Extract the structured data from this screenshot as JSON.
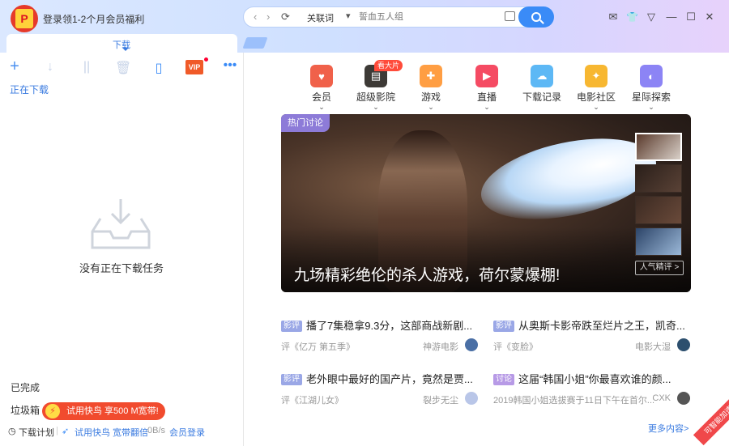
{
  "window": {
    "login_text": "登录领1-2个月会员福利",
    "avatar_letter": "P",
    "controls": {
      "mail": "✉",
      "skin": "👕",
      "menu": "▽",
      "minimize": "—",
      "maximize": "☐",
      "close": "✕"
    }
  },
  "search": {
    "back": "‹",
    "forward": "›",
    "refresh": "⟳",
    "keyword_label": "关联词",
    "keyword_arrow": "▾",
    "placeholder": "誓血五人组"
  },
  "tabs": {
    "active_label": "下载"
  },
  "toolbar": {
    "add": "+",
    "download": "↓",
    "pause": "||",
    "delete": "🗑",
    "phone": "▯",
    "vip": "VIP",
    "more": "•••"
  },
  "left": {
    "downloading_label": "正在下载",
    "empty_text": "没有正在下载任务",
    "completed_label": "已完成",
    "trash_label": "垃圾箱",
    "promo_text": "试用快鸟 享500 M宽带!",
    "status": {
      "schedule_icon": "◷",
      "schedule": "下载计划",
      "trial_icon": "➶",
      "trial_text": "试用快鸟 宽带翻倍",
      "speed": "0B/s",
      "member_login": "会员登录"
    }
  },
  "categories": [
    {
      "label": "会员",
      "icon": "heart-icon",
      "color": "#f0614a",
      "glyph": "♥",
      "has_chevron": true
    },
    {
      "label": "超级影院",
      "icon": "film-icon",
      "color": "#3d3a36",
      "glyph": "▤",
      "has_chevron": true
    },
    {
      "label": "游戏",
      "icon": "gamepad-icon",
      "color": "#ff9e43",
      "glyph": "✚",
      "has_chevron": true
    },
    {
      "label": "直播",
      "icon": "tv-icon",
      "color": "#f54b63",
      "glyph": "▶",
      "has_chevron": true
    },
    {
      "label": "下载记录",
      "icon": "cloud-icon",
      "color": "#5db8f5",
      "glyph": "☁",
      "has_chevron": false
    },
    {
      "label": "电影社区",
      "icon": "bird-icon",
      "color": "#f7b731",
      "glyph": "✦",
      "has_chevron": true
    },
    {
      "label": "星际探索",
      "icon": "planet-icon",
      "color": "#8c84f5",
      "glyph": "◐",
      "has_chevron": true
    }
  ],
  "hot_badge": "看大片",
  "hero": {
    "tag": "热门讨论",
    "title": "九场精彩绝伦的杀人游戏，荷尔蒙爆棚!",
    "popular_button": "人气精评 >"
  },
  "news": [
    {
      "chip": "影评",
      "chip_style": "blue",
      "title": "播了7集稳拿9.3分，这部商战新剧...",
      "meta": "评《亿万 第五季》",
      "source": "神游电影",
      "avatar_color": "#4a6fa5"
    },
    {
      "chip": "影评",
      "chip_style": "blue",
      "title": "从奥斯卡影帝跌至烂片之王，凯奇...",
      "meta": "评《变脸》",
      "source": "电影大湿",
      "avatar_color": "#2c4f6e"
    },
    {
      "chip": "影评",
      "chip_style": "blue",
      "title": "老外眼中最好的国产片，竟然是贾...",
      "meta": "评《江湖儿女》",
      "source": "裂步无尘",
      "avatar_color": "#b9c6e8"
    },
    {
      "chip": "讨论",
      "chip_style": "purple",
      "title": "这届“韩国小姐”你最喜欢谁的颜...",
      "meta": "2019韩国小姐选拔赛于11日下午在首尔...",
      "source": "CXK",
      "avatar_color": "#555555"
    }
  ],
  "more_link": "更多内容>",
  "corner_ribbon": "可智能加速"
}
